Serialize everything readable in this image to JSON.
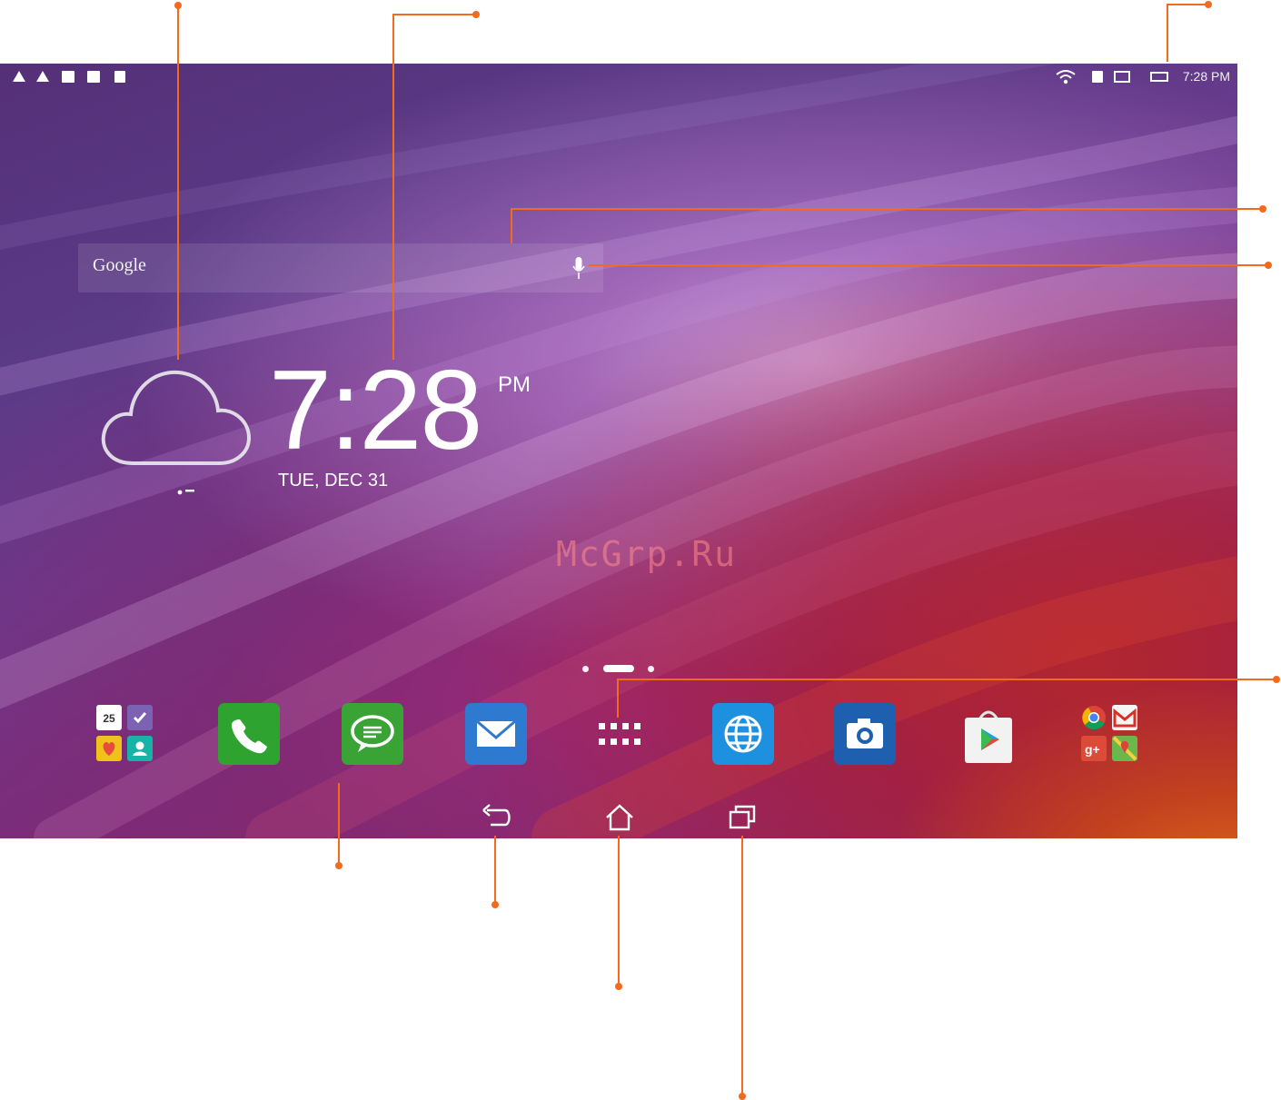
{
  "status_bar": {
    "time": "7:28 PM",
    "left_icons": [
      "warning-icon",
      "warning-icon",
      "image-notification-icon",
      "edit-notification-icon",
      "file-notification-icon"
    ],
    "right_icons": [
      "wifi-icon",
      "sim-icon",
      "screenshot-icon",
      "battery-icon"
    ]
  },
  "search": {
    "label": "Google",
    "voice_icon": "microphone-icon"
  },
  "clock": {
    "time": "7:28",
    "ampm": "PM",
    "date": "TUE, DEC 31"
  },
  "weather": {
    "icon": "cloud-icon"
  },
  "watermark": "McGrp.Ru",
  "pages": {
    "count": 3,
    "current": 2
  },
  "dock": [
    {
      "name": "productivity-folder",
      "icon": "folder-icon"
    },
    {
      "name": "phone",
      "icon": "phone-icon"
    },
    {
      "name": "messaging",
      "icon": "message-icon"
    },
    {
      "name": "email",
      "icon": "mail-icon"
    },
    {
      "name": "all-apps",
      "icon": "apps-grid-icon"
    },
    {
      "name": "browser",
      "icon": "globe-icon"
    },
    {
      "name": "camera",
      "icon": "camera-icon"
    },
    {
      "name": "play-store",
      "icon": "play-store-icon"
    },
    {
      "name": "google-folder",
      "icon": "folder-icon"
    }
  ],
  "folder_badge": "25",
  "colors": {
    "annotation": "#f26a1b",
    "phone": "#2fa32f",
    "messaging": "#3aa336",
    "email": "#2f7ad1",
    "browser": "#1e90e0",
    "camera": "#1f5fb0"
  },
  "nav": [
    "back-icon",
    "home-icon",
    "recent-apps-icon"
  ]
}
